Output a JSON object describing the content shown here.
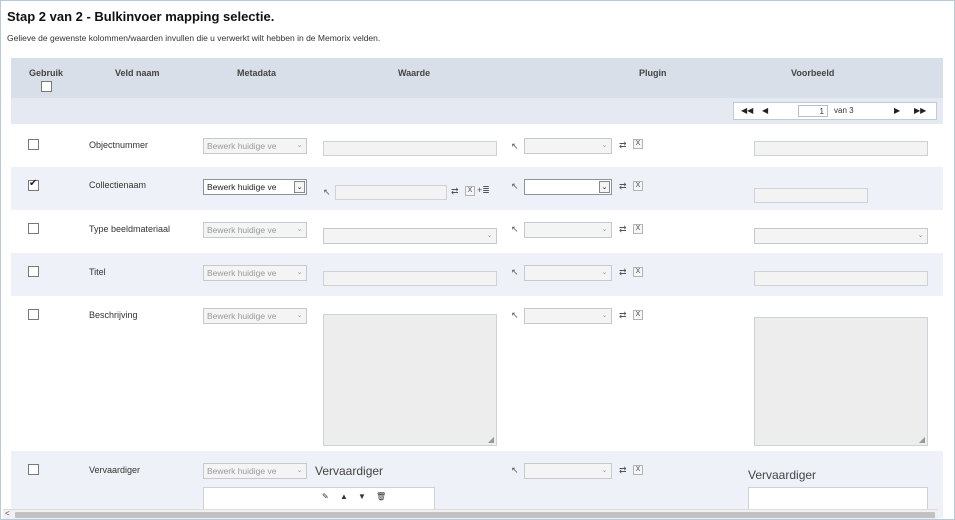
{
  "page": {
    "title": "Stap 2 van 2 - Bulkinvoer mapping selectie.",
    "subtitle": "Gelieve de gewenste kolommen/waarden invullen die u verwerkt wilt hebben in de Memorix velden."
  },
  "columns": {
    "use": "Gebruik",
    "field_name": "Veld naam",
    "metadata": "Metadata",
    "value": "Waarde",
    "plugin": "Plugin",
    "example": "Voorbeeld"
  },
  "pager": {
    "first_icon": "first-page-icon",
    "prev_icon": "prev-page-icon",
    "next_icon": "next-page-icon",
    "last_icon": "last-page-icon",
    "first": "◀◀",
    "prev": "◀",
    "page": "1",
    "of_label": "van 3",
    "next": "▶",
    "last": "▶▶"
  },
  "metadata_option": "Bewerk huidige ve",
  "rows": [
    {
      "name": "Objectnummer",
      "checked": false
    },
    {
      "name": "Collectienaam",
      "checked": true
    },
    {
      "name": "Type beeldmateriaal",
      "checked": false
    },
    {
      "name": "Titel",
      "checked": false
    },
    {
      "name": "Beschrijving",
      "checked": false
    },
    {
      "name": "Vervaardiger",
      "checked": false,
      "value_label": "Vervaardiger",
      "example_label": "Vervaardiger"
    }
  ],
  "icons": {
    "plugin_link": "link-icon",
    "refresh": "refresh-icon",
    "remove": "remove-icon",
    "list": "list-icon",
    "edit": "edit-icon",
    "move_up": "move-up-icon",
    "move_down": "move-down-icon",
    "delete": "trash-icon"
  },
  "glyphs": {
    "x": "X",
    "dropdown": "⌄",
    "scroll_left": "<"
  },
  "colors": {
    "header_bg": "#d9dfe8",
    "row_alt_bg": "#eef1f7",
    "disabled_field": "#f3f3f3"
  }
}
